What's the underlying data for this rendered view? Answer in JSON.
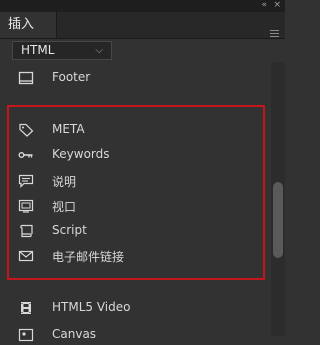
{
  "panel": {
    "tab_label": "插入",
    "collapse_glyph": "«",
    "close_glyph": "×",
    "menu_icon": "hamburger-icon"
  },
  "category_select": {
    "value": "HTML",
    "icon": "chevron-down-icon"
  },
  "items": [
    {
      "label": "Footer",
      "icon": "footer-icon"
    },
    {
      "label": "META",
      "icon": "tag-icon"
    },
    {
      "label": "Keywords",
      "icon": "key-icon"
    },
    {
      "label": "说明",
      "icon": "comment-icon"
    },
    {
      "label": "视口",
      "icon": "viewport-icon"
    },
    {
      "label": "Script",
      "icon": "script-scroll-icon"
    },
    {
      "label": "电子邮件链接",
      "icon": "envelope-icon"
    },
    {
      "label": "HTML5 Video",
      "icon": "video-film-icon"
    },
    {
      "label": "Canvas",
      "icon": "canvas-icon"
    }
  ],
  "colors": {
    "highlight_border": "#c4161c",
    "panel_bg": "#323232"
  }
}
